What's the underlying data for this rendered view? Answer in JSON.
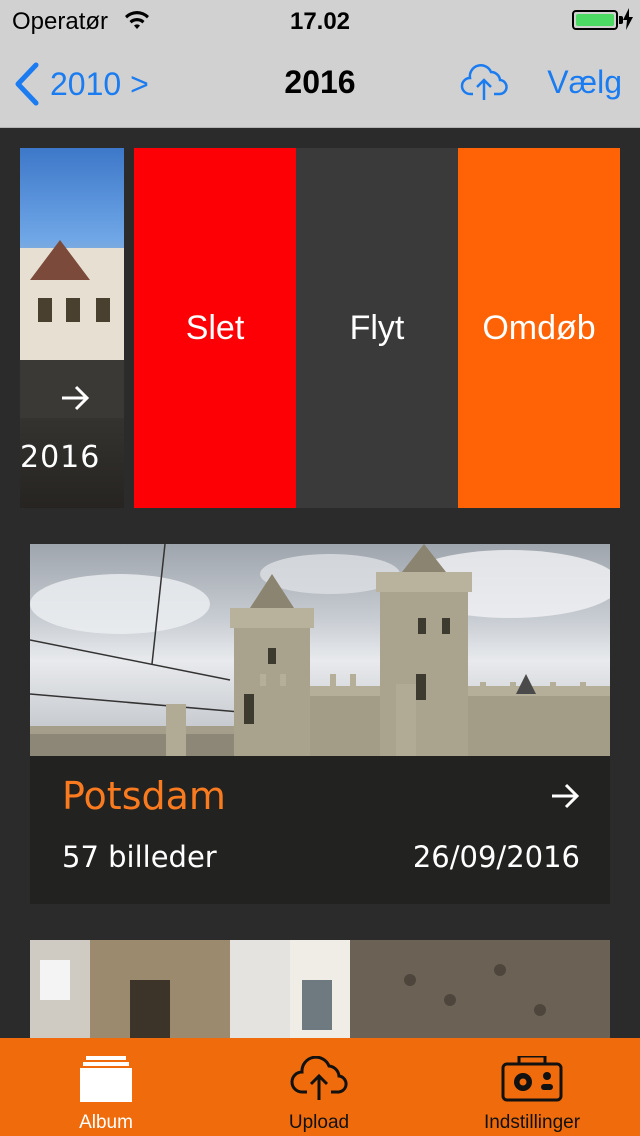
{
  "status_bar": {
    "carrier": "Operatør",
    "time": "17.02"
  },
  "nav": {
    "back_label": "2010 >",
    "title": "2016",
    "select_label": "Vælg",
    "accent_color": "#1a7cf0"
  },
  "swipe_row": {
    "album_year": "2016",
    "actions": {
      "delete": "Slet",
      "move": "Flyt",
      "rename": "Omdøb"
    },
    "colors": {
      "delete": "#fd0006",
      "move": "#3a3a3a",
      "rename": "#ff6305"
    }
  },
  "albums": [
    {
      "title": "Potsdam",
      "count": "57 billeder",
      "date": "26/09/2016"
    }
  ],
  "tab_bar": {
    "tabs": [
      {
        "label": "Album",
        "icon": "album-icon",
        "selected": true
      },
      {
        "label": "Upload",
        "icon": "cloud-upload-icon",
        "selected": false
      },
      {
        "label": "Indstillinger",
        "icon": "settings-camera-icon",
        "selected": false
      }
    ],
    "color": "#f06b0c"
  }
}
